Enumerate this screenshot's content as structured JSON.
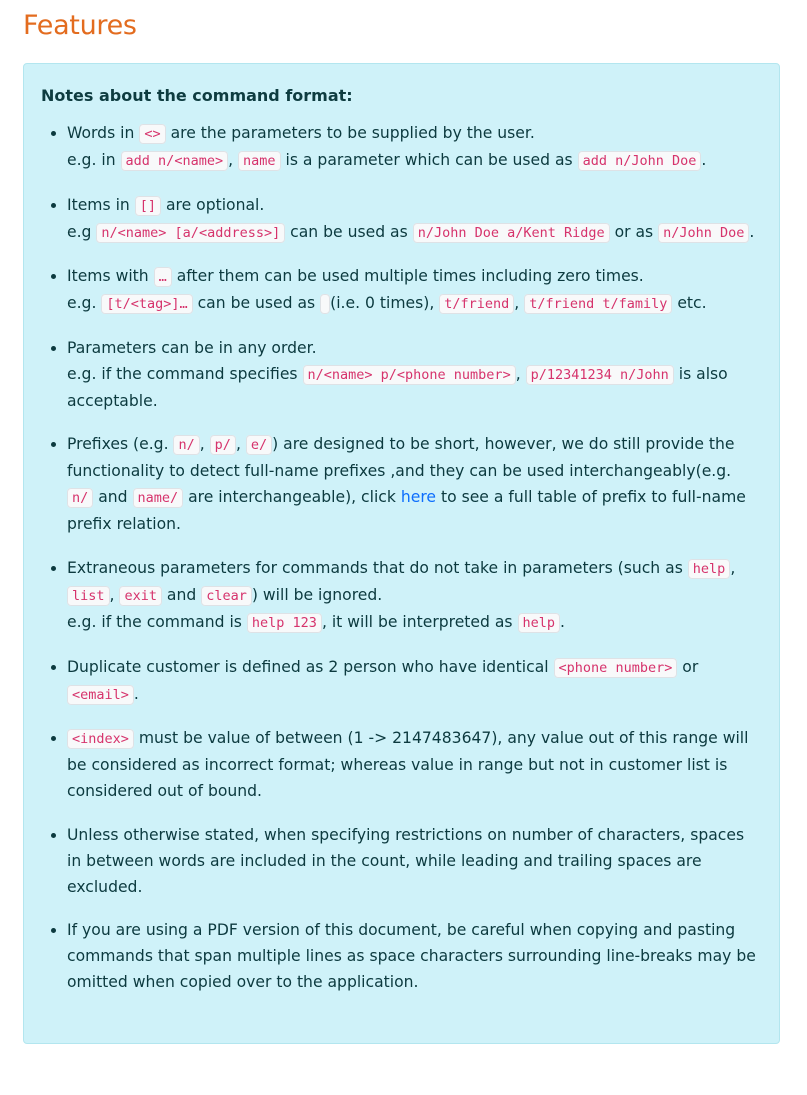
{
  "page": {
    "title": "Features"
  },
  "notes": {
    "heading": "Notes about the command format:",
    "items": [
      {
        "parts": [
          {
            "t": "Words in "
          },
          {
            "c": "<>"
          },
          {
            "t": " are the parameters to be supplied by the user."
          },
          {
            "br": true
          },
          {
            "t": "e.g. in "
          },
          {
            "c": "add n/<name>"
          },
          {
            "t": ", "
          },
          {
            "c": "name"
          },
          {
            "t": " is a parameter which can be used as "
          },
          {
            "c": "add n/John Doe"
          },
          {
            "t": "."
          }
        ]
      },
      {
        "parts": [
          {
            "t": "Items in "
          },
          {
            "c": "[]"
          },
          {
            "t": " are optional."
          },
          {
            "br": true
          },
          {
            "t": "e.g "
          },
          {
            "c": "n/<name> [a/<address>]"
          },
          {
            "t": " can be used as "
          },
          {
            "c": "n/John Doe a/Kent Ridge"
          },
          {
            "t": " or as "
          },
          {
            "c": "n/John Doe"
          },
          {
            "t": "."
          }
        ]
      },
      {
        "parts": [
          {
            "t": "Items with "
          },
          {
            "c": "…"
          },
          {
            "t": " after them can be used multiple times including zero times."
          },
          {
            "br": true
          },
          {
            "t": "e.g. "
          },
          {
            "c": "[t/<tag>]…"
          },
          {
            "t": " can be used as "
          },
          {
            "c": " "
          },
          {
            "t": "(i.e. 0 times), "
          },
          {
            "c": "t/friend"
          },
          {
            "t": ", "
          },
          {
            "c": "t/friend t/family"
          },
          {
            "t": " etc."
          }
        ]
      },
      {
        "parts": [
          {
            "t": "Parameters can be in any order."
          },
          {
            "br": true
          },
          {
            "t": "e.g. if the command specifies "
          },
          {
            "c": "n/<name> p/<phone number>"
          },
          {
            "t": ", "
          },
          {
            "c": "p/12341234 n/John"
          },
          {
            "t": " is also acceptable."
          }
        ]
      },
      {
        "parts": [
          {
            "t": "Prefixes (e.g. "
          },
          {
            "c": "n/"
          },
          {
            "t": ", "
          },
          {
            "c": "p/"
          },
          {
            "t": ", "
          },
          {
            "c": "e/"
          },
          {
            "t": ") are designed to be short, however, we do still provide the functionality to detect full-name prefixes ,and they can be used interchangeably(e.g. "
          },
          {
            "c": "n/"
          },
          {
            "t": " and "
          },
          {
            "c": "name/"
          },
          {
            "t": " are interchangeable), click "
          },
          {
            "a": "here"
          },
          {
            "t": " to see a full table of prefix to full-name prefix relation."
          }
        ]
      },
      {
        "parts": [
          {
            "t": "Extraneous parameters for commands that do not take in parameters (such as "
          },
          {
            "c": "help"
          },
          {
            "t": ", "
          },
          {
            "c": "list"
          },
          {
            "t": ", "
          },
          {
            "c": "exit"
          },
          {
            "t": " and "
          },
          {
            "c": "clear"
          },
          {
            "t": ") will be ignored."
          },
          {
            "br": true
          },
          {
            "t": "e.g. if the command is "
          },
          {
            "c": "help 123"
          },
          {
            "t": ", it will be interpreted as "
          },
          {
            "c": "help"
          },
          {
            "t": "."
          }
        ]
      },
      {
        "parts": [
          {
            "t": "Duplicate customer is defined as 2 person who have identical "
          },
          {
            "c": "<phone number>"
          },
          {
            "t": " or "
          },
          {
            "c": "<email>"
          },
          {
            "t": "."
          }
        ]
      },
      {
        "parts": [
          {
            "c": "<index>"
          },
          {
            "t": " must be value of between (1 -> 2147483647), any value out of this range will be considered as incorrect format; whereas value in range but not in customer list is considered out of bound."
          }
        ]
      },
      {
        "parts": [
          {
            "t": "Unless otherwise stated, when specifying restrictions on number of characters, spaces in between words are included in the count, while leading and trailing spaces are excluded."
          }
        ]
      },
      {
        "parts": [
          {
            "t": "If you are using a PDF version of this document, be careful when copying and pasting commands that span multiple lines as space characters surrounding line-breaks may be omitted when copied over to the application."
          }
        ]
      }
    ]
  }
}
